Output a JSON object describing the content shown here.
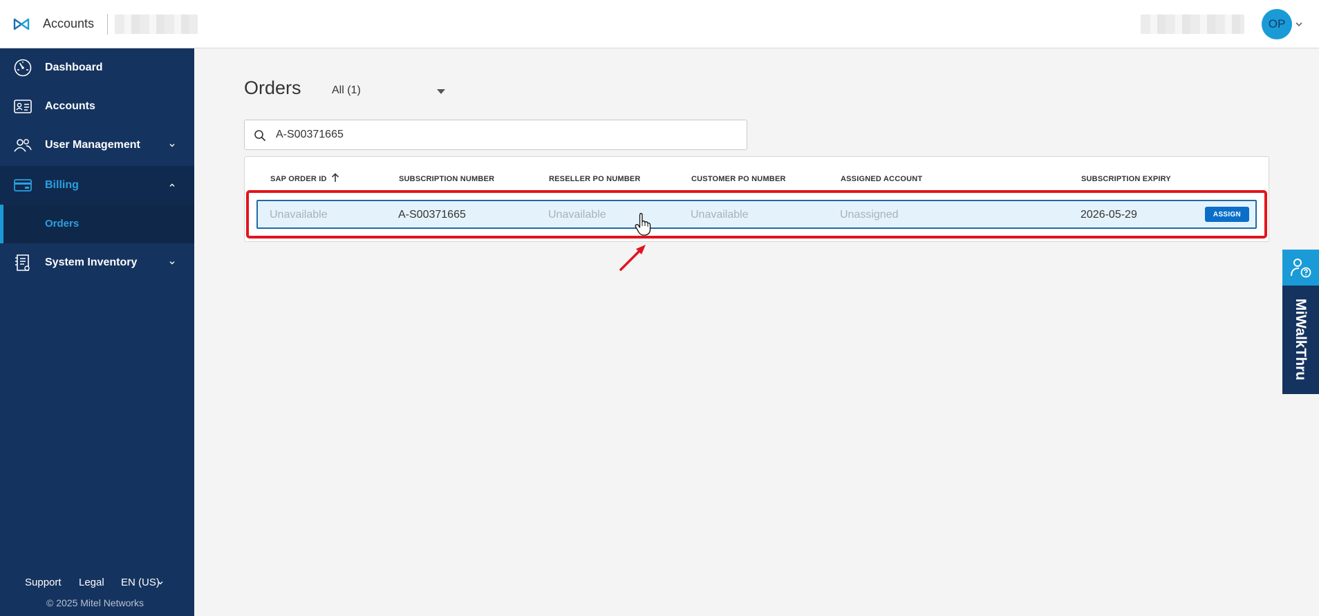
{
  "header": {
    "app_title": "Accounts",
    "avatar_initials": "OP"
  },
  "sidebar": {
    "items": [
      {
        "label": "Dashboard",
        "icon": "dashboard-gauge-icon"
      },
      {
        "label": "Accounts",
        "icon": "id-card-icon"
      },
      {
        "label": "User Management",
        "icon": "users-icon"
      },
      {
        "label": "Billing",
        "icon": "credit-card-icon"
      },
      {
        "label": "System Inventory",
        "icon": "document-list-icon"
      }
    ],
    "billing_sub": {
      "label": "Orders"
    },
    "footer": {
      "support": "Support",
      "legal": "Legal",
      "language": "EN (US)",
      "copyright": "© 2025 Mitel Networks"
    }
  },
  "main": {
    "title": "Orders",
    "filter_value": "All (1)",
    "search_value": "A-S00371665",
    "table": {
      "columns": [
        "SAP ORDER ID",
        "SUBSCRIPTION NUMBER",
        "RESELLER PO NUMBER",
        "CUSTOMER PO NUMBER",
        "ASSIGNED ACCOUNT",
        "SUBSCRIPTION EXPIRY"
      ],
      "rows": [
        {
          "sap_order_id": "Unavailable",
          "subscription_number": "A-S00371665",
          "reseller_po": "Unavailable",
          "customer_po": "Unavailable",
          "assigned_account": "Unassigned",
          "subscription_expiry": "2026-05-29",
          "action_label": "ASSIGN"
        }
      ]
    }
  },
  "walkthru": {
    "label": "MiWalkThru"
  },
  "colors": {
    "sidebar_bg": "#15335f",
    "accent": "#1a9bd7",
    "highlight": "#e1141e",
    "assign_button": "#0b6fc9"
  }
}
